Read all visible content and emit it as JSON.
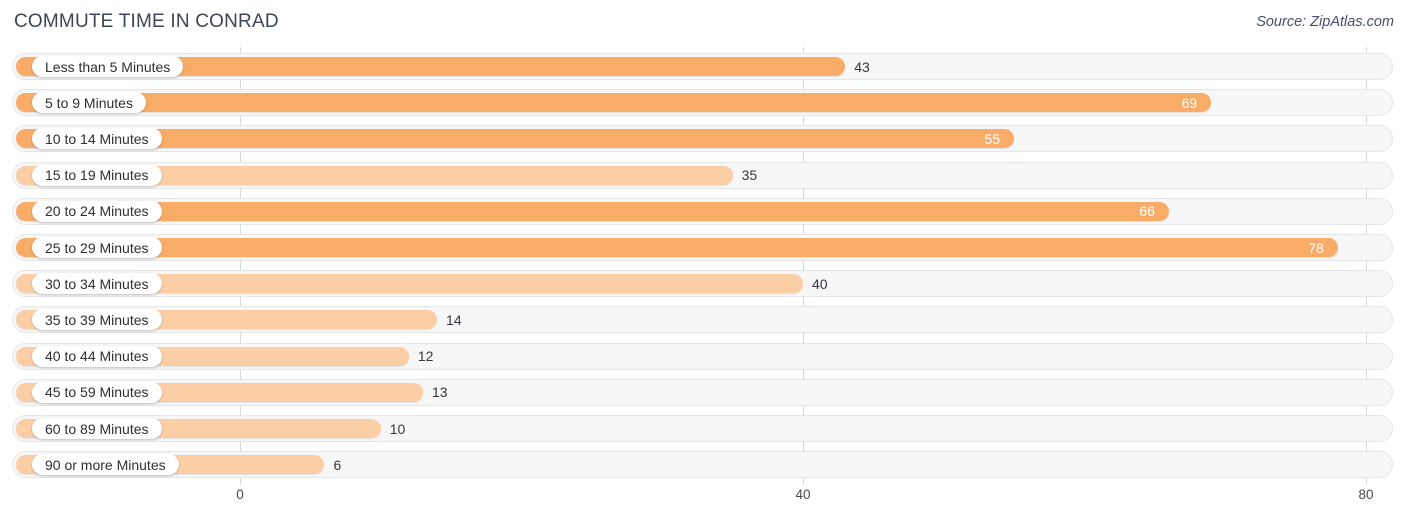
{
  "header": {
    "title": "COMMUTE TIME IN CONRAD",
    "source": "Source: ZipAtlas.com"
  },
  "colors": {
    "bar_strong": "#f8ac68",
    "bar_light": "#fbcea5",
    "track_bg": "#f7f7f7",
    "track_border": "#e6e6e6",
    "gridline": "#d8d8d8",
    "label_text": "#2f2f33",
    "value_text_outside": "#33373f",
    "value_text_inside": "#ffffff"
  },
  "chart_data": {
    "type": "bar",
    "orientation": "horizontal",
    "title": "COMMUTE TIME IN CONRAD",
    "xlabel": "",
    "ylabel": "",
    "xlim": [
      0,
      80
    ],
    "xticks": [
      0,
      40,
      80
    ],
    "xtick_labels": [
      "0",
      "40",
      "80"
    ],
    "grid": true,
    "legend": "none",
    "categories": [
      "Less than 5 Minutes",
      "5 to 9 Minutes",
      "10 to 14 Minutes",
      "15 to 19 Minutes",
      "20 to 24 Minutes",
      "25 to 29 Minutes",
      "30 to 34 Minutes",
      "35 to 39 Minutes",
      "40 to 44 Minutes",
      "45 to 59 Minutes",
      "60 to 89 Minutes",
      "90 or more Minutes"
    ],
    "values": [
      43,
      69,
      55,
      35,
      66,
      78,
      40,
      14,
      12,
      13,
      10,
      6
    ],
    "value_labels": [
      "43",
      "69",
      "55",
      "35",
      "66",
      "78",
      "40",
      "14",
      "12",
      "13",
      "10",
      "6"
    ],
    "bars": [
      {
        "label": "Less than 5 Minutes",
        "value": 43,
        "text": "43",
        "shade": "strong",
        "label_position": "outside"
      },
      {
        "label": "5 to 9 Minutes",
        "value": 69,
        "text": "69",
        "shade": "strong",
        "label_position": "inside"
      },
      {
        "label": "10 to 14 Minutes",
        "value": 55,
        "text": "55",
        "shade": "strong",
        "label_position": "inside"
      },
      {
        "label": "15 to 19 Minutes",
        "value": 35,
        "text": "35",
        "shade": "light",
        "label_position": "outside"
      },
      {
        "label": "20 to 24 Minutes",
        "value": 66,
        "text": "66",
        "shade": "strong",
        "label_position": "inside"
      },
      {
        "label": "25 to 29 Minutes",
        "value": 78,
        "text": "78",
        "shade": "strong",
        "label_position": "inside"
      },
      {
        "label": "30 to 34 Minutes",
        "value": 40,
        "text": "40",
        "shade": "light",
        "label_position": "outside"
      },
      {
        "label": "35 to 39 Minutes",
        "value": 14,
        "text": "14",
        "shade": "light",
        "label_position": "outside"
      },
      {
        "label": "40 to 44 Minutes",
        "value": 12,
        "text": "12",
        "shade": "light",
        "label_position": "outside"
      },
      {
        "label": "45 to 59 Minutes",
        "value": 13,
        "text": "13",
        "shade": "light",
        "label_position": "outside"
      },
      {
        "label": "60 to 89 Minutes",
        "value": 10,
        "text": "10",
        "shade": "light",
        "label_position": "outside"
      },
      {
        "label": "90 or more Minutes",
        "value": 6,
        "text": "6",
        "shade": "light",
        "label_position": "outside"
      }
    ]
  }
}
